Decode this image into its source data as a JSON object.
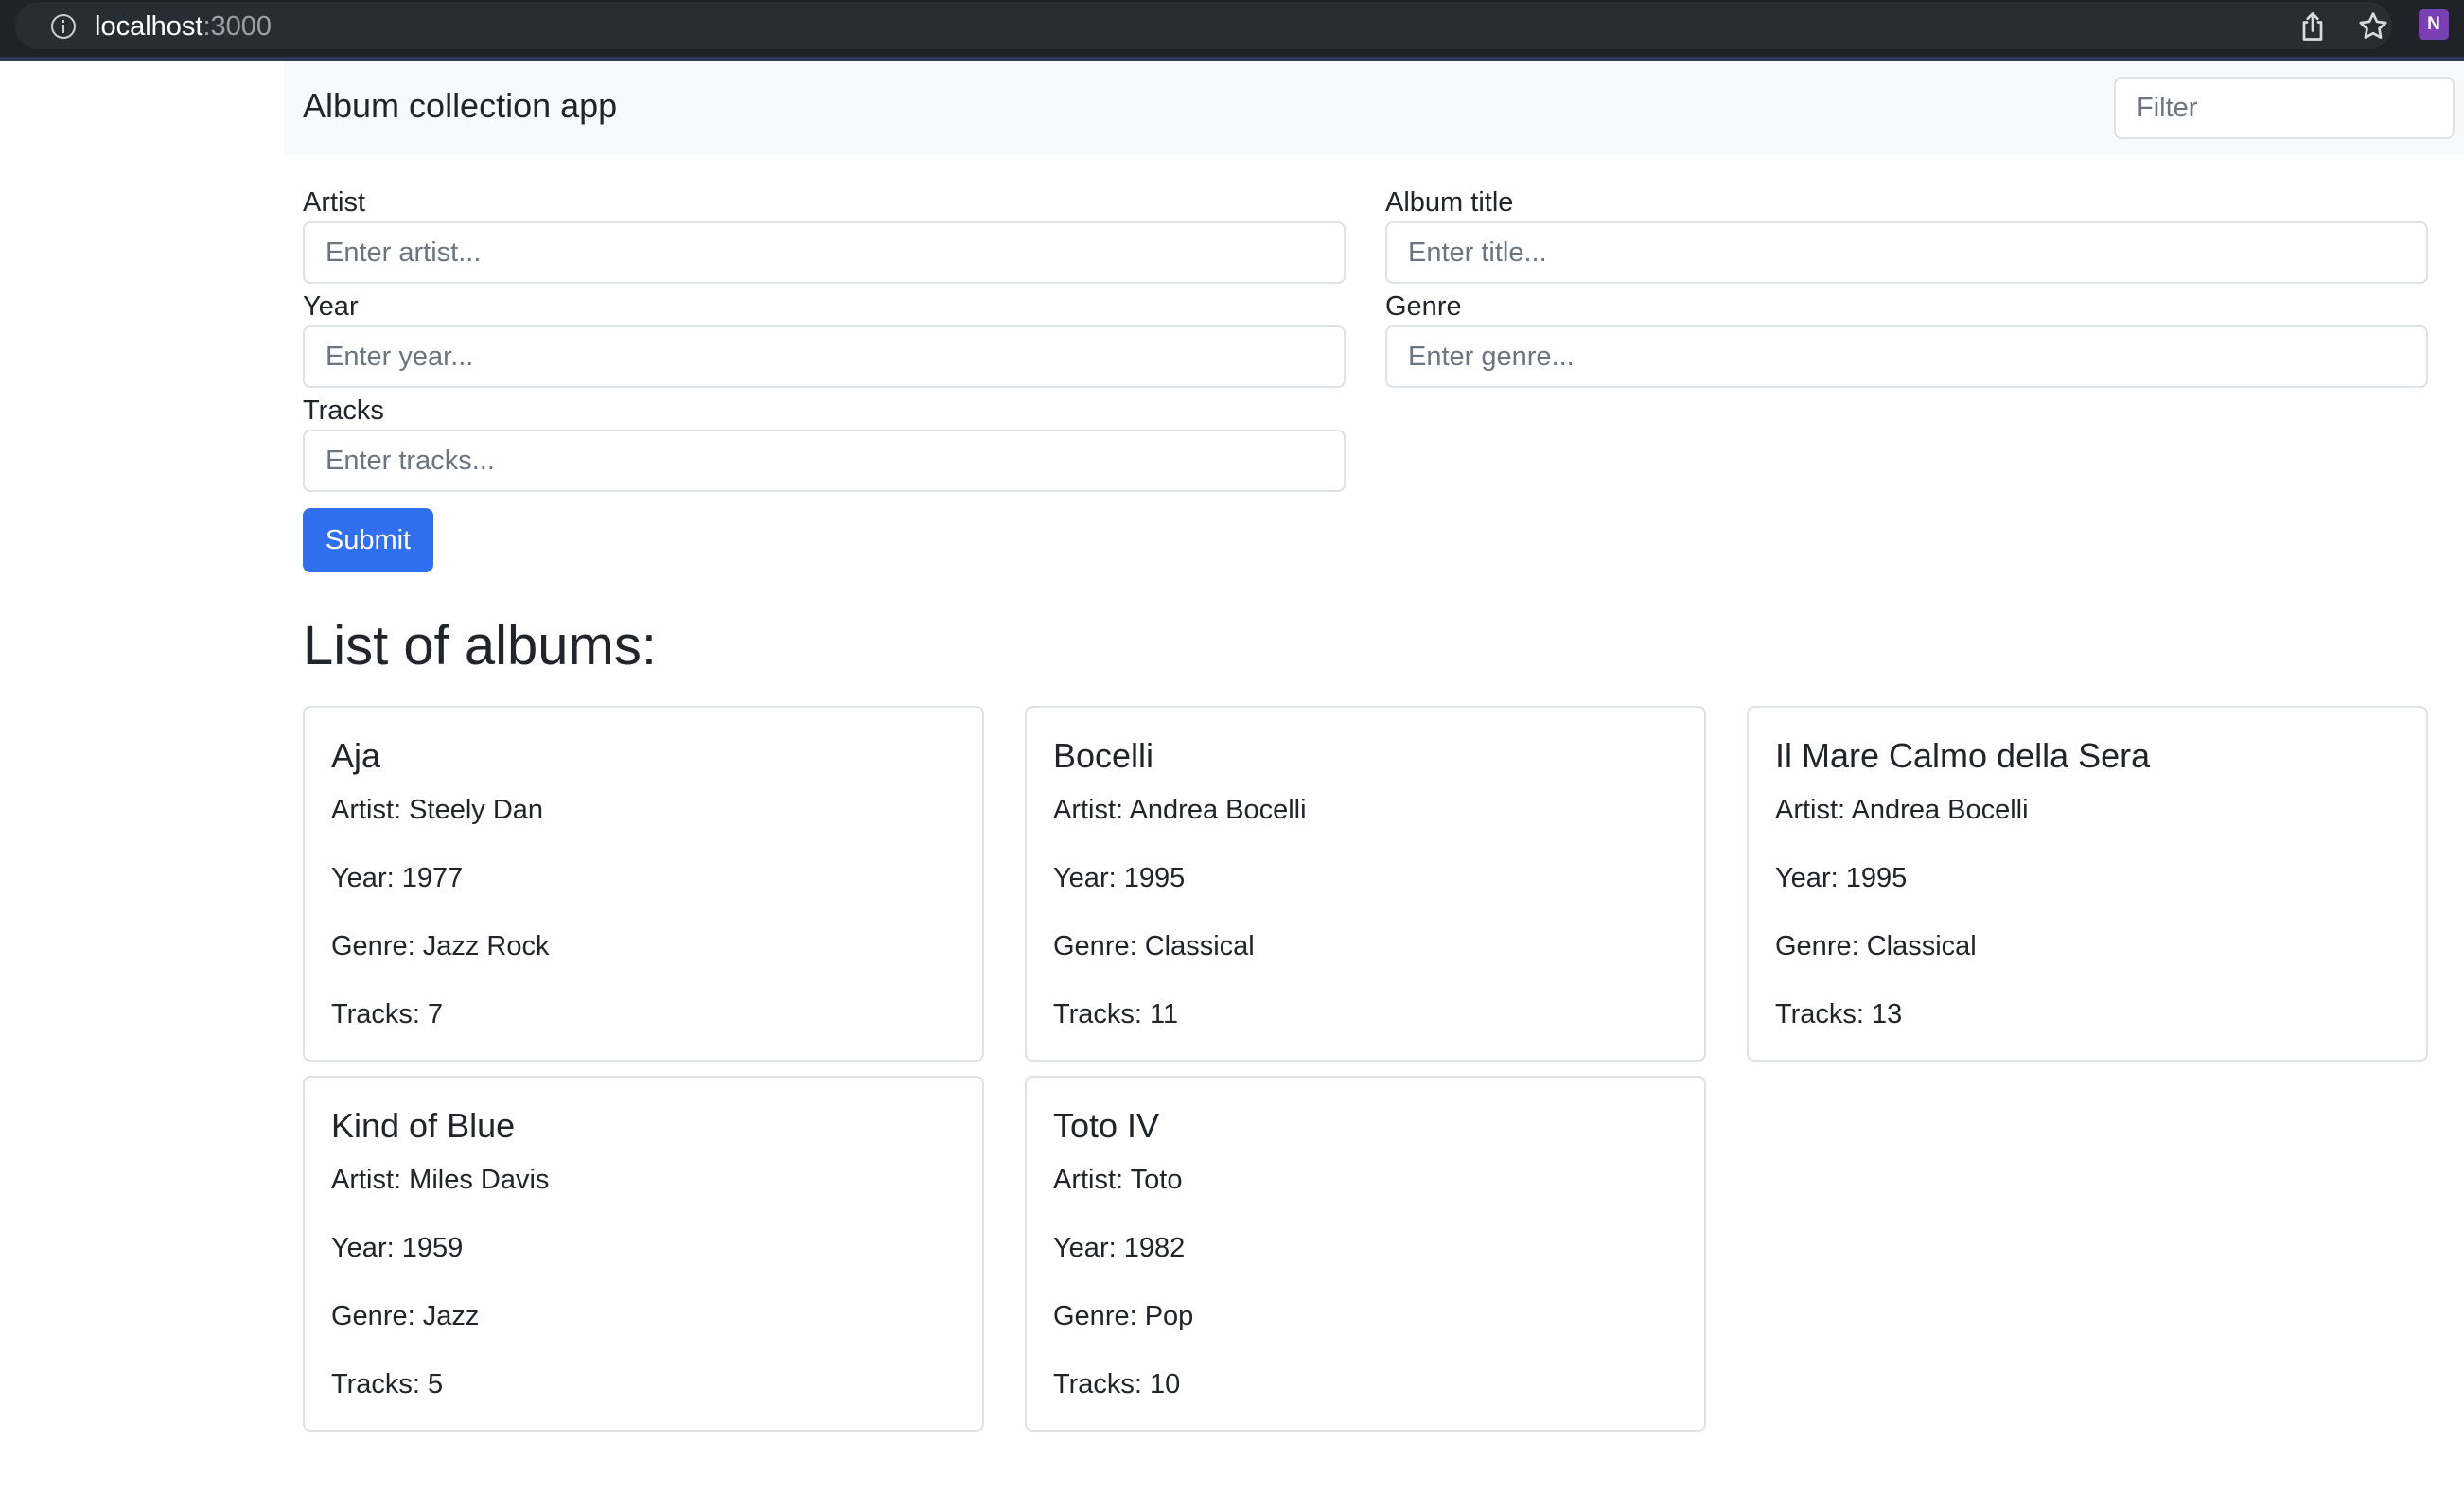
{
  "browser": {
    "url_host": "localhost",
    "url_port": ":3000",
    "icons": [
      "info-icon",
      "share-icon",
      "star-icon",
      "onenote-extension-icon"
    ]
  },
  "navbar": {
    "brand": "Album collection app",
    "filter_placeholder": "Filter",
    "filter_value": ""
  },
  "form": {
    "artist": {
      "label": "Artist",
      "placeholder": "Enter artist...",
      "value": ""
    },
    "title": {
      "label": "Album title",
      "placeholder": "Enter title...",
      "value": ""
    },
    "year": {
      "label": "Year",
      "placeholder": "Enter year...",
      "value": ""
    },
    "genre": {
      "label": "Genre",
      "placeholder": "Enter genre...",
      "value": ""
    },
    "tracks": {
      "label": "Tracks",
      "placeholder": "Enter tracks...",
      "value": ""
    },
    "submit_label": "Submit"
  },
  "list_heading": "List of albums:",
  "albums": [
    {
      "title": "Aja",
      "artist": "Artist: Steely Dan",
      "year": "Year: 1977",
      "genre": "Genre: Jazz Rock",
      "tracks": "Tracks: 7"
    },
    {
      "title": "Bocelli",
      "artist": "Artist: Andrea Bocelli",
      "year": "Year: 1995",
      "genre": "Genre: Classical",
      "tracks": "Tracks: 11"
    },
    {
      "title": "Il Mare Calmo della Sera",
      "artist": "Artist: Andrea Bocelli",
      "year": "Year: 1995",
      "genre": "Genre: Classical",
      "tracks": "Tracks: 13"
    },
    {
      "title": "Kind of Blue",
      "artist": "Artist: Miles Davis",
      "year": "Year: 1959",
      "genre": "Genre: Jazz",
      "tracks": "Tracks: 5"
    },
    {
      "title": "Toto IV",
      "artist": "Artist: Toto",
      "year": "Year: 1982",
      "genre": "Genre: Pop",
      "tracks": "Tracks: 10"
    }
  ],
  "colors": {
    "primary": "#2f6ff0",
    "navbar_bg": "#f8f9fa",
    "border": "#dee2e6",
    "text": "#212529",
    "placeholder": "#6c757d",
    "browser_bar": "#1f2329"
  }
}
